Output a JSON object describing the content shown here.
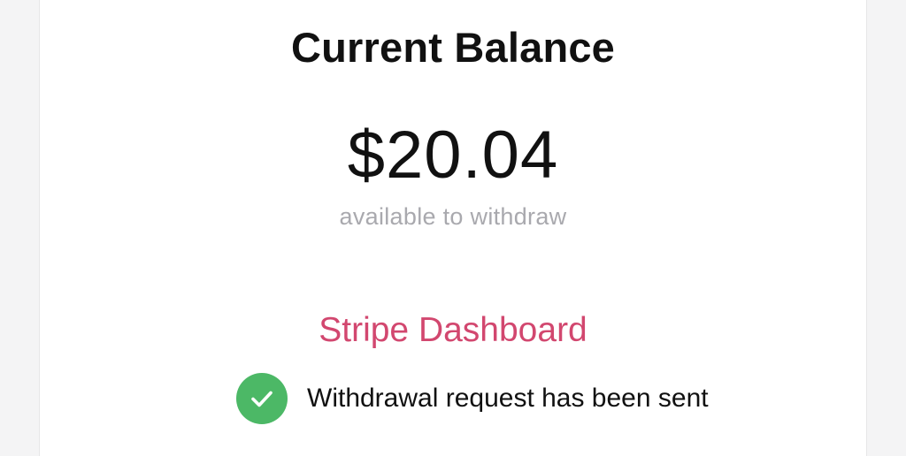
{
  "balance": {
    "title": "Current Balance",
    "amount": "$20.04",
    "subtitle": "available to withdraw"
  },
  "dashboard_link": {
    "label": "Stripe Dashboard",
    "color": "#d2476f"
  },
  "status": {
    "icon": "checkmark-circle-icon",
    "icon_color": "#4cb866",
    "message": "Withdrawal request has been sent"
  }
}
